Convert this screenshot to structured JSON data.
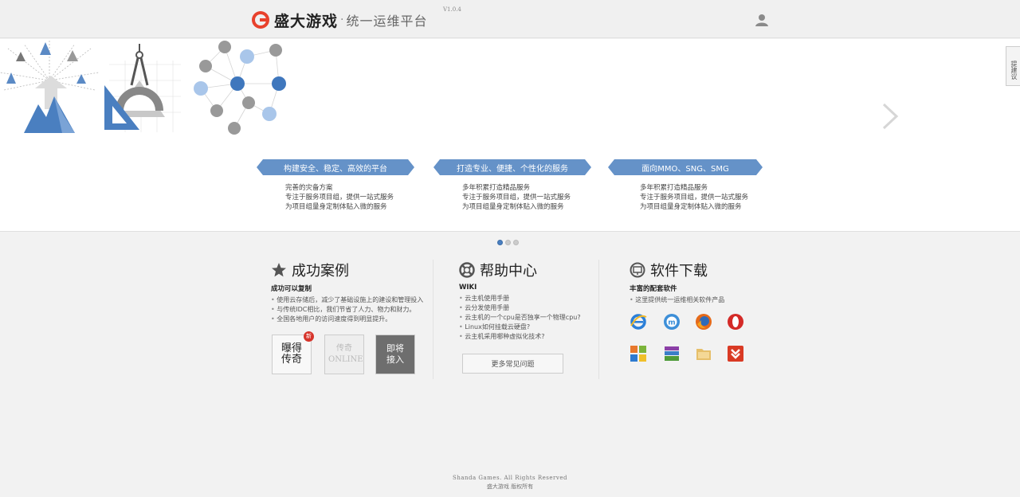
{
  "header": {
    "brand": "盛大游戏",
    "separator": "·",
    "subtitle": "统一运维平台",
    "version": "V1.0.4"
  },
  "side_tab": {
    "label": "提建议"
  },
  "features": [
    {
      "title": "构建安全、稳定、高效的平台",
      "lines": [
        "完善的灾备方案",
        "专注于服务项目组，提供一站式服务",
        "为项目组量身定制体贴入微的服务"
      ]
    },
    {
      "title": "打造专业、便捷、个性化的服务",
      "lines": [
        "多年积累打造精品服务",
        "专注于服务项目组，提供一站式服务",
        "为项目组量身定制体贴入微的服务"
      ]
    },
    {
      "title": "面向MMO、SNG、SMG",
      "lines": [
        "多年积累打造精品服务",
        "专注于服务项目组，提供一站式服务",
        "为项目组量身定制体贴入微的服务"
      ]
    }
  ],
  "carousel": {
    "total": 3,
    "active": 1
  },
  "cases": {
    "title": "成功案例",
    "subtitle": "成功可以复制",
    "items": [
      "使用云存储后，减少了基础设施上的建设和管理投入",
      "与传统IDC相比，我们节省了人力、物力和财力。",
      "全国各地用户的访问速度得到明显提升。"
    ],
    "thumbs": [
      {
        "label": "曝得传奇",
        "badge": "新"
      },
      {
        "label": "传奇ONLINE"
      },
      {
        "label": "即将接入"
      }
    ]
  },
  "help": {
    "title": "帮助中心",
    "subtitle": "WIKI",
    "items": [
      "云主机使用手册",
      "云分发使用手册",
      "云主机的一个cpu是否独享一个物理cpu?",
      "Linux如何挂载云硬盘?",
      "云主机采用哪种虚拟化技术?"
    ],
    "more_label": "更多常见问题"
  },
  "download": {
    "title": "软件下载",
    "subtitle": "丰富的配套软件",
    "items": [
      "这里提供统一运维相关软件产品"
    ],
    "icons": [
      "ie-icon",
      "maxthon-icon",
      "firefox-icon",
      "opera-icon",
      "office-icon",
      "winrar-icon",
      "folder-icon",
      "download-tool-icon"
    ]
  },
  "footer": {
    "copyright_en": "Shanda Games. All Rights Reserved",
    "copyright_cn": "盛大游戏 版权所有"
  }
}
